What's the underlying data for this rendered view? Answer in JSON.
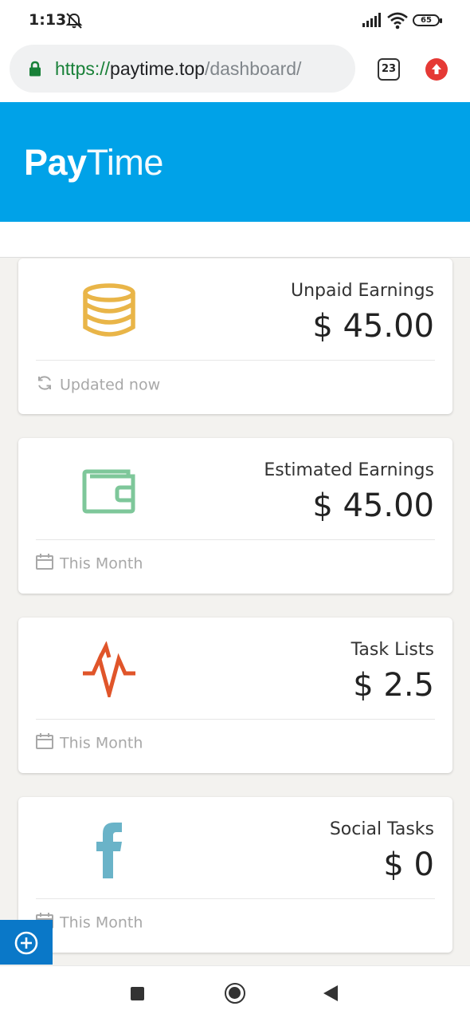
{
  "status_bar": {
    "time": "1:13",
    "battery": "65"
  },
  "browser": {
    "url_scheme": "https://",
    "url_host": "paytime.top",
    "url_path": "/dashboard/",
    "tab_count": "23"
  },
  "header": {
    "brand_bold": "Pay",
    "brand_light": "Time",
    "brand_color": "#00a2e8"
  },
  "cards": [
    {
      "title": "Unpaid Earnings",
      "value": "$ 45.00",
      "footer": "Updated now",
      "icon": "coins-icon",
      "icon_color": "#e9b548"
    },
    {
      "title": "Estimated Earnings",
      "value": "$ 45.00",
      "footer": "This Month",
      "icon": "wallet-icon",
      "icon_color": "#7ec79a"
    },
    {
      "title": "Task Lists",
      "value": "$ 2.5",
      "footer": "This Month",
      "icon": "pulse-icon",
      "icon_color": "#e0552a"
    },
    {
      "title": "Social Tasks",
      "value": "$ 0",
      "footer": "This Month",
      "icon": "facebook-icon",
      "icon_color": "#6ab3c8"
    }
  ]
}
